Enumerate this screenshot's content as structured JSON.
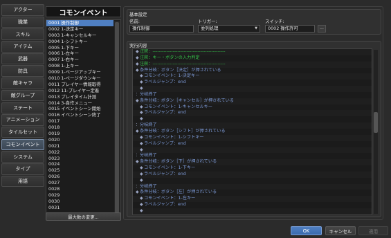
{
  "tabs": [
    {
      "label": "アクター"
    },
    {
      "label": "職業"
    },
    {
      "label": "スキル"
    },
    {
      "label": "アイテム"
    },
    {
      "label": "武器"
    },
    {
      "label": "防具"
    },
    {
      "label": "敵キャラ"
    },
    {
      "label": "敵グループ"
    },
    {
      "label": "ステート"
    },
    {
      "label": "アニメーション"
    },
    {
      "label": "タイルセット"
    },
    {
      "label": "コモンイベント"
    },
    {
      "label": "システム"
    },
    {
      "label": "タイプ"
    },
    {
      "label": "用語"
    }
  ],
  "active_tab_index": 11,
  "event_list": {
    "title": "コモンイベント",
    "selected_index": 0,
    "items": [
      "0001 操作制御",
      "0002 1-決定キー",
      "0003 1-キャンセルキー",
      "0004 1-シフトキー",
      "0005 1-下キー",
      "0006 1-左キー",
      "0007 1-右キー",
      "0008 1-上キー",
      "0009 1-ページアップキー",
      "0010 1-ページダウンキー",
      "0011 プレイヤー情報取得",
      "0012 11-プレイヤー定着",
      "0013 プレイタイム計測",
      "0014 3-自作メニュー",
      "0015 イベントシーン開始",
      "0016 イベントシーン終了",
      "0017",
      "0018",
      "0019",
      "0020",
      "0021",
      "0022",
      "0023",
      "0024",
      "0025",
      "0026",
      "0027",
      "0028",
      "0029",
      "0030",
      "0031"
    ],
    "max_button_label": "最大数の変更..."
  },
  "basic_settings": {
    "section_label": "基本設定",
    "name_label": "名前:",
    "name_value": "操作制御",
    "trigger_label": "トリガー:",
    "trigger_value": "並列処理",
    "switch_label": "スイッチ:",
    "switch_value": "0002 操作許可",
    "switch_button": "..."
  },
  "commands": {
    "section_label": "実行内容",
    "lines": [
      {
        "mark": "◆",
        "text": "注釈：-----------------------------------------------",
        "kind": "comment",
        "indent": 0
      },
      {
        "mark": "◆",
        "text": "注釈：キー・ボタンの入力判定",
        "kind": "comment",
        "indent": 0
      },
      {
        "mark": "◆",
        "text": "注釈：-----------------------------------------------",
        "kind": "comment",
        "indent": 0
      },
      {
        "mark": "◆",
        "text": "条件分岐：ボタン［決定］が押されている",
        "kind": "cond",
        "indent": 0
      },
      {
        "mark": "◆",
        "text": "コモンイベント：1-決定キー",
        "kind": "sub",
        "indent": 1
      },
      {
        "mark": "◆",
        "text": "ラベルジャンプ：end",
        "kind": "sub",
        "indent": 1
      },
      {
        "mark": "◆",
        "text": "",
        "kind": "sub",
        "indent": 1
      },
      {
        "mark": "：",
        "text": "分岐終了",
        "kind": "end",
        "indent": 0
      },
      {
        "mark": "◆",
        "text": "条件分岐：ボタン［キャンセル］が押されている",
        "kind": "cond",
        "indent": 0
      },
      {
        "mark": "◆",
        "text": "コモンイベント：1-キャンセルキー",
        "kind": "sub",
        "indent": 1
      },
      {
        "mark": "◆",
        "text": "ラベルジャンプ：end",
        "kind": "sub",
        "indent": 1
      },
      {
        "mark": "◆",
        "text": "",
        "kind": "sub",
        "indent": 1
      },
      {
        "mark": "：",
        "text": "分岐終了",
        "kind": "end",
        "indent": 0
      },
      {
        "mark": "◆",
        "text": "条件分岐：ボタン［シフト］が押されている",
        "kind": "cond",
        "indent": 0
      },
      {
        "mark": "◆",
        "text": "コモンイベント：1-シフトキー",
        "kind": "sub",
        "indent": 1
      },
      {
        "mark": "◆",
        "text": "ラベルジャンプ：end",
        "kind": "sub",
        "indent": 1
      },
      {
        "mark": "◆",
        "text": "",
        "kind": "sub",
        "indent": 1
      },
      {
        "mark": "：",
        "text": "分岐終了",
        "kind": "end",
        "indent": 0
      },
      {
        "mark": "◆",
        "text": "条件分岐：ボタン［下］が押されている",
        "kind": "cond",
        "indent": 0
      },
      {
        "mark": "◆",
        "text": "コモンイベント：1-下キー",
        "kind": "sub",
        "indent": 1
      },
      {
        "mark": "◆",
        "text": "ラベルジャンプ：end",
        "kind": "sub",
        "indent": 1
      },
      {
        "mark": "◆",
        "text": "",
        "kind": "sub",
        "indent": 1
      },
      {
        "mark": "：",
        "text": "分岐終了",
        "kind": "end",
        "indent": 0
      },
      {
        "mark": "◆",
        "text": "条件分岐：ボタン［左］が押されている",
        "kind": "cond",
        "indent": 0
      },
      {
        "mark": "◆",
        "text": "コモンイベント：1-左キー",
        "kind": "sub",
        "indent": 1
      },
      {
        "mark": "◆",
        "text": "ラベルジャンプ：end",
        "kind": "sub",
        "indent": 1
      },
      {
        "mark": "◆",
        "text": "",
        "kind": "sub",
        "indent": 1
      }
    ]
  },
  "footer": {
    "ok_label": "OK",
    "cancel_label": "キャンセル",
    "apply_label": "適用"
  },
  "colors": {
    "accent": "#4f7fc2",
    "comment": "#36c24a",
    "command": "#7d9bd8",
    "background": "#2b2b2b"
  }
}
